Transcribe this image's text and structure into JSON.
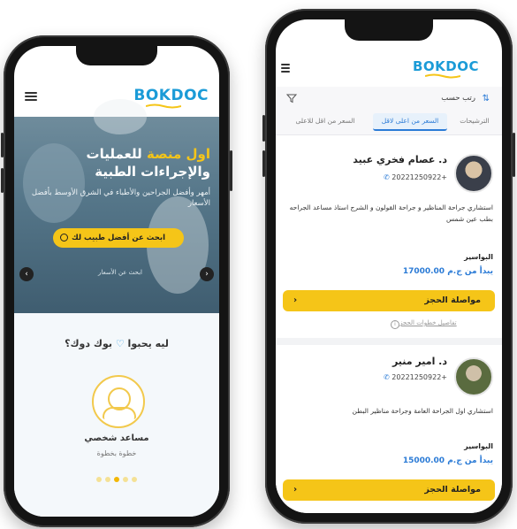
{
  "left": {
    "logo": {
      "part1": "BOK",
      "part2": "DOC"
    },
    "hero": {
      "title_highlight": "اول منصة",
      "title_rest": "للعمليات والإجراءات الطبية",
      "subtitle": "أمهر وأفضل الجراحين والأطباء في الشرق الأوسط بأفضل الأسعار",
      "cta": "ابحث عن أفضل طبيب لك",
      "link": "ابحث عن الأسعار",
      "prev": "‹",
      "next": "›"
    },
    "why": {
      "title_pre": "ليه يحبوا",
      "title_post": "بوك دوك؟",
      "feature_title": "مساعد شخصي",
      "feature_sub": "خطوة بخطوة"
    }
  },
  "right": {
    "logo": {
      "part1": "BOK",
      "part2": "DOC"
    },
    "sort": {
      "label": "رتب حسب",
      "tabs": [
        "الترشيحات",
        "السعر من اعلى لاقل",
        "السعر من اقل للاعلى"
      ],
      "active_index": 1
    },
    "doctors": [
      {
        "name": "د. عصام فخري عبيد",
        "phone": "+20221250922",
        "desc": "استشاري جراحة المناظير و جراحة القولون و الشرج استاذ مساعد الجراحه بطب عين شمس",
        "location": "البواسير",
        "price": "يبدأ من ج.م 17000.00",
        "book": "مواصلة الحجز",
        "details": "تفاصيل خطوات الحجز"
      },
      {
        "name": "د. امير منير",
        "phone": "+20221250922",
        "desc": "استشاري اول الجراحة العامة وجراحة مناظير البطن",
        "location": "البواسير",
        "price": "يبدأ من ج.م 15000.00",
        "book": "مواصلة الحجز"
      }
    ]
  },
  "colors": {
    "accent": "#f5c518",
    "brand": "#1b9bd7",
    "link": "#2b7bd6"
  }
}
